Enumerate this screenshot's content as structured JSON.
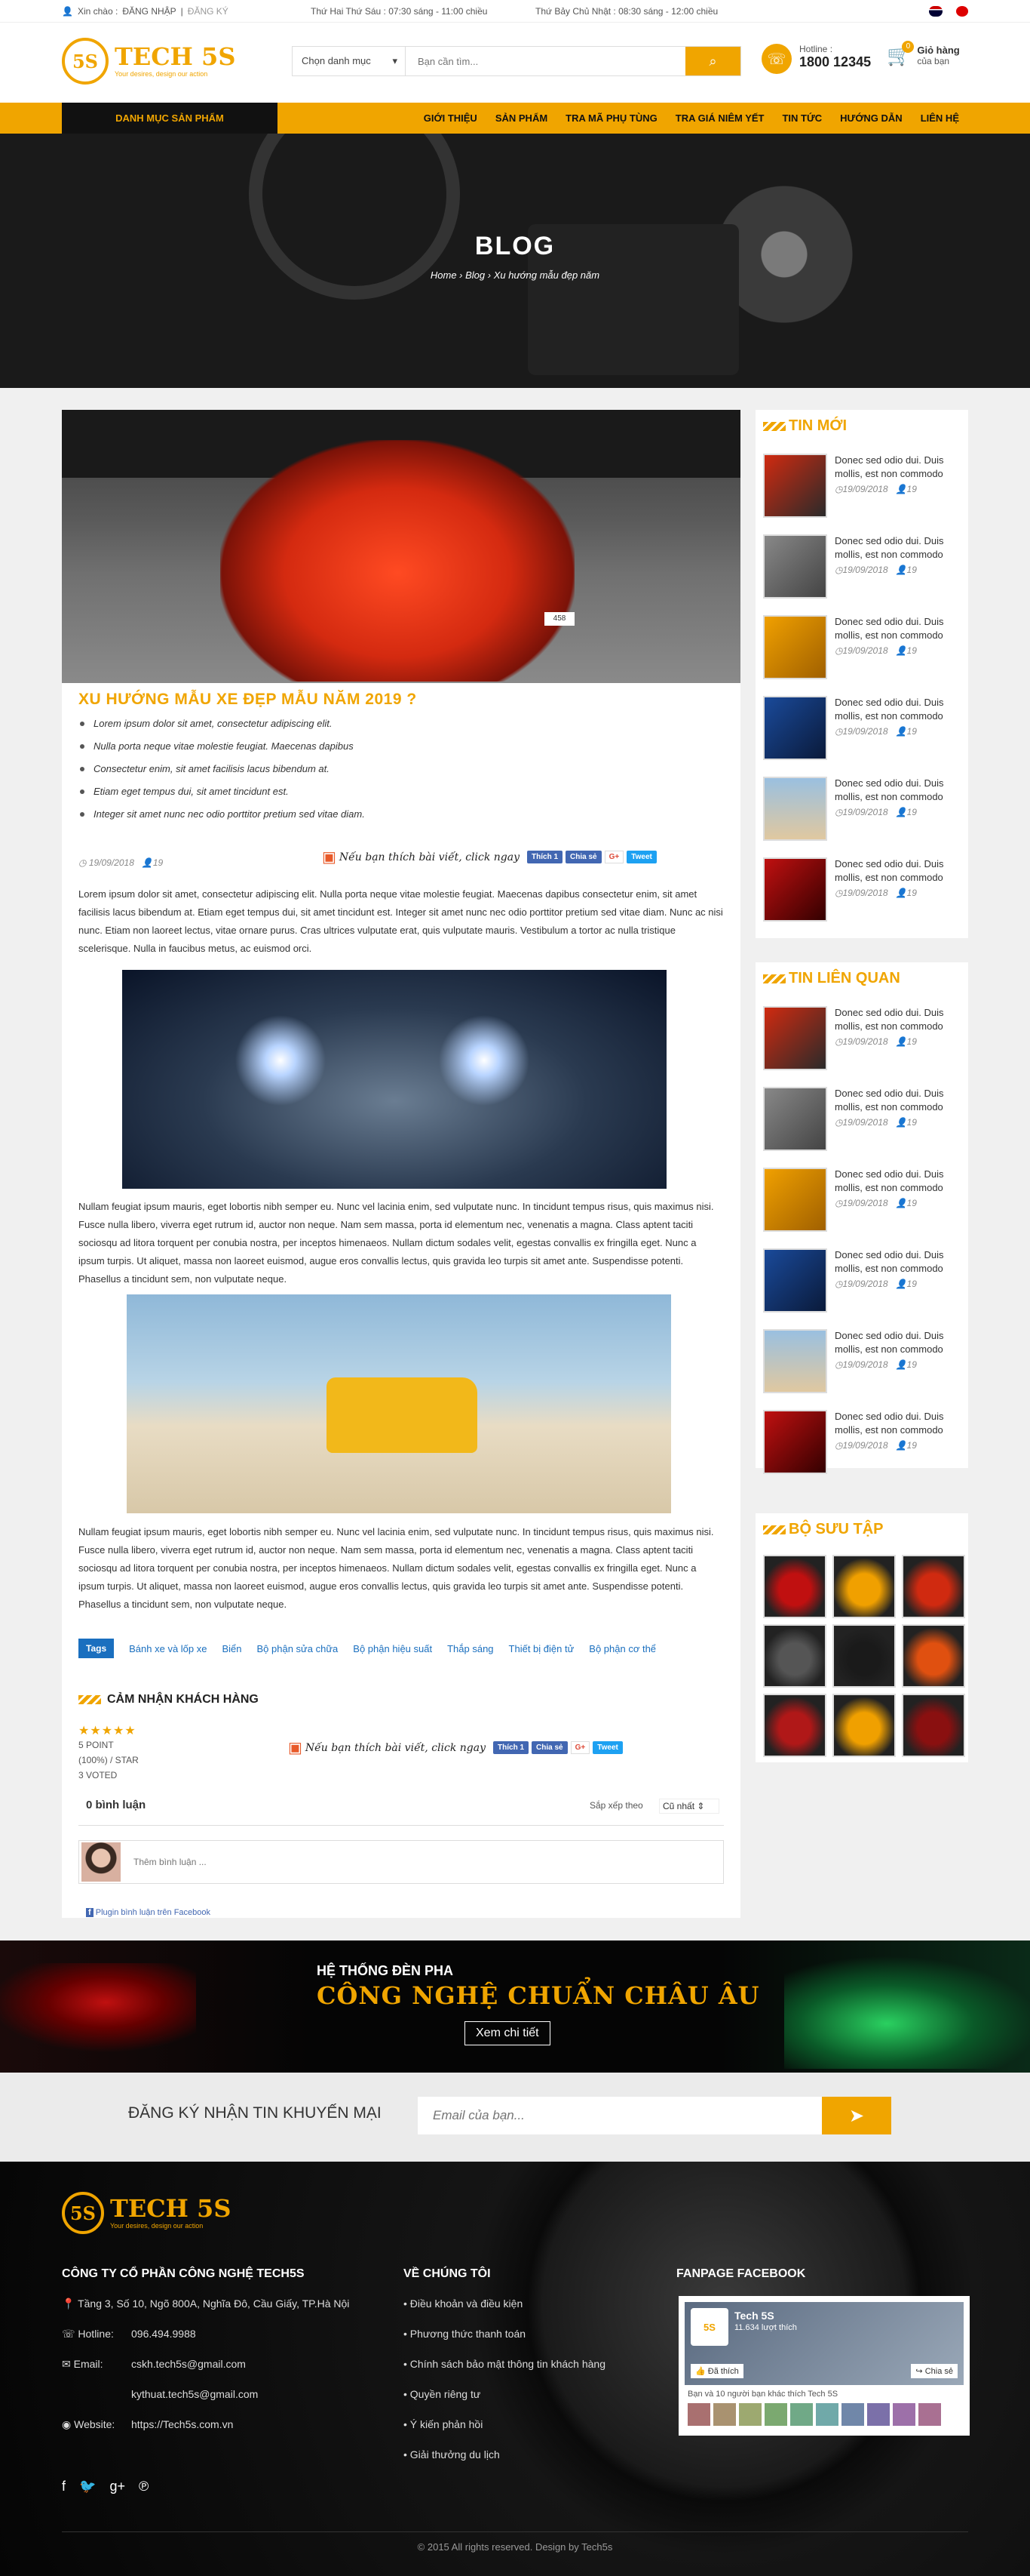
{
  "topbar": {
    "greeting": "Xin chào :",
    "login": "ĐĂNG NHẬP",
    "register": "ĐĂNG KÝ",
    "hours1": "Thứ Hai Thứ Sáu : 07:30 sáng - 11:00 chiều",
    "hours2": "Thứ Bảy Chủ Nhật : 08:30 sáng - 12:00 chiều"
  },
  "header": {
    "logo": "TECH 5S",
    "logo_sub": "Your desires, design our action",
    "category_select": "Chọn danh mục",
    "search_placeholder": "Bạn cần tìm...",
    "hotline_label": "Hotline :",
    "hotline_number": "1800 12345",
    "cart_label": "Giỏ hàng",
    "cart_sub": "của bạn",
    "cart_count": "0"
  },
  "nav": {
    "category": "DANH MỤC SẢN PHẨM",
    "items": [
      "GIỚI THIỆU",
      "SẢN PHẨM",
      "TRA MÃ PHỤ TÙNG",
      "TRA GIÁ NIÊM YẾT",
      "TIN TỨC",
      "HƯỚNG DẪN",
      "LIÊN HỆ"
    ]
  },
  "hero": {
    "title": "BLOG",
    "breadcrumb": "Home  ›  Blog  ›  Xu hướng mẫu đẹp năm"
  },
  "article": {
    "plate": "458",
    "title": "XU HƯỚNG MẪU XE ĐẸP MẪU NĂM 2019 ?",
    "bullets": [
      "Lorem ipsum dolor sit amet, consectetur adipiscing elit.",
      "Nulla porta neque vitae molestie feugiat. Maecenas dapibus",
      "Consectetur enim, sit amet facilisis lacus bibendum at.",
      "Etiam eget tempus dui, sit amet tincidunt est.",
      "Integer sit amet nunc nec odio porttitor pretium sed vitae diam."
    ],
    "date": "19/09/2018",
    "views": "19",
    "like_hint": "Nếu bạn thích bài viết, click ngay",
    "like": "Thích 1",
    "share": "Chia sẻ",
    "gplus": "G+",
    "tweet": "Tweet",
    "para1": "Lorem ipsum dolor sit amet, consectetur adipiscing elit. Nulla porta neque vitae molestie feugiat. Maecenas dapibus consectetur enim, sit amet facilisis lacus bibendum at. Etiam eget tempus dui, sit amet tincidunt est. Integer sit amet nunc nec odio porttitor pretium sed vitae diam. Nunc ac nisi nunc. Etiam non laoreet lectus, vitae ornare purus. Cras ultrices vulputate erat, quis vulputate mauris. Vestibulum a tortor ac nulla tristique scelerisque. Nulla in faucibus metus, ac euismod orci.",
    "para2": "Nullam feugiat ipsum mauris, eget lobortis nibh semper eu. Nunc vel lacinia enim, sed vulputate nunc. In tincidunt tempus risus, quis maximus nisi. Fusce nulla libero, viverra eget rutrum id, auctor non neque. Nam sem massa, porta id elementum nec, venenatis a magna. Class aptent taciti sociosqu ad litora torquent per conubia nostra, per inceptos himenaeos. Nullam dictum sodales velit, egestas convallis ex fringilla eget. Nunc a ipsum turpis. Ut aliquet, massa non laoreet euismod, augue eros convallis lectus, quis gravida leo turpis sit amet ante. Suspendisse potenti. Phasellus a tincidunt sem, non vulputate neque.",
    "para3": "Nullam feugiat ipsum mauris, eget lobortis nibh semper eu. Nunc vel lacinia enim, sed vulputate nunc. In tincidunt tempus risus, quis maximus nisi. Fusce nulla libero, viverra eget rutrum id, auctor non neque. Nam sem massa, porta id elementum nec, venenatis a magna. Class aptent taciti sociosqu ad litora torquent per conubia nostra, per inceptos himenaeos. Nullam dictum sodales velit, egestas convallis ex fringilla eget. Nunc a ipsum turpis. Ut aliquet, massa non laoreet euismod, augue eros convallis lectus, quis gravida leo turpis sit amet ante. Suspendisse potenti. Phasellus a tincidunt sem, non vulputate neque.",
    "tags_label": "Tags",
    "tags": [
      "Bánh xe và lốp xe",
      "Biển",
      "Bộ phận sửa chữa",
      "Bộ phận hiệu suất",
      "Thắp sáng",
      "Thiết bị điện tử",
      "Bộ phận cơ thể"
    ],
    "rating_title": "CẢM NHẬN KHÁCH HÀNG",
    "stars": "★★★★★",
    "point": "5 POINT",
    "percent": "(100%) / STAR",
    "voted": "3 VOTED",
    "comments_count": "0 bình luận",
    "sort_label": "Sắp xếp theo",
    "sort_value": "Cũ nhất",
    "comment_placeholder": "Thêm bình luận ...",
    "fb_plugin": "Plugin bình luận trên Facebook"
  },
  "sidebar": {
    "new_title": "TIN MỚI",
    "related_title": "TIN LIÊN QUAN",
    "gallery_title": "BỘ SƯU TẬP",
    "post_title": "Donec sed odio dui. Duis mollis, est non commodo",
    "post_date": "19/09/2018",
    "post_views": "19"
  },
  "banner": {
    "line1": "HỆ THỐNG ĐÈN PHA",
    "line2": "CÔNG NGHỆ CHUẨN CHÂU ÂU",
    "button": "Xem chi tiết"
  },
  "newsletter": {
    "label": "ĐĂNG KÝ NHẬN TIN KHUYẾN MẠI",
    "placeholder": "Email của bạn..."
  },
  "footer": {
    "company": "CÔNG TY CỔ PHẦN CÔNG NGHỆ TECH5S",
    "address": "Tầng 3, Số 10, Ngõ 800A, Nghĩa Đô, Cầu Giấy, TP.Hà Nội",
    "hotline_label": "Hotline:",
    "hotline": "096.494.9988",
    "email_label": "Email:",
    "email1": "cskh.tech5s@gmail.com",
    "email2": "kythuat.tech5s@gmail.com",
    "website_label": "Website:",
    "website": "https://Tech5s.com.vn",
    "about_title": "VỀ CHÚNG TÔI",
    "links": [
      "Điều khoản và điều kiện",
      "Phương thức thanh toán",
      "Chính sách bảo mật thông tin khách hàng",
      "Quyền riêng tư",
      "Ý kiến phản hồi",
      "Giải thưởng du lịch"
    ],
    "fanpage_title": "FANPAGE FACEBOOK",
    "fb_name": "Tech 5S",
    "fb_likes": "11.634 lượt thích",
    "fb_liked": "Đã thích",
    "fb_share": "Chia sẻ",
    "fb_friends": "Bạn và 10 người bạn khác thích Tech 5S",
    "copyright": "© 2015 All rights reserved. Design by Tech5s"
  },
  "colors": {
    "accent": "#f0a500",
    "dark": "#111111",
    "link": "#1a6fbf"
  }
}
